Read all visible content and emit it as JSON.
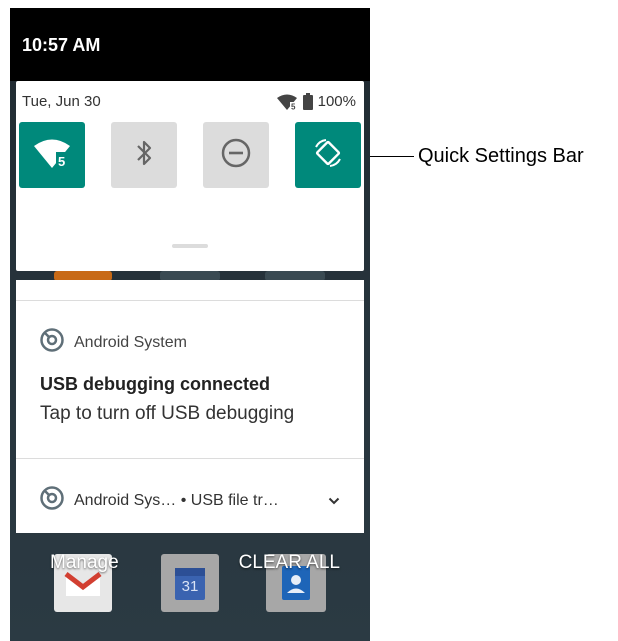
{
  "status_bar": {
    "time": "10:57 AM"
  },
  "quick_settings": {
    "date": "Tue, Jun 30",
    "battery": "100%",
    "tiles": [
      {
        "name": "wifi",
        "icon": "wifi-icon",
        "state": "on",
        "badge": "5"
      },
      {
        "name": "bluetooth",
        "icon": "bluetooth-icon",
        "state": "off"
      },
      {
        "name": "do-not-disturb",
        "icon": "do-not-disturb-icon",
        "state": "off"
      },
      {
        "name": "auto-rotate",
        "icon": "auto-rotate-icon",
        "state": "on"
      }
    ],
    "accent_color": "#00897b"
  },
  "notifications": [
    {
      "app": "Android System",
      "title": "USB debugging connected",
      "text": "Tap to turn off USB debugging"
    },
    {
      "app_summary": "Android Sys… • USB file tr…"
    }
  ],
  "actions": {
    "manage": "Manage",
    "clear_all": "CLEAR ALL"
  },
  "background_icons": {
    "calendar_date": "31"
  },
  "callout": {
    "label": "Quick Settings Bar"
  }
}
